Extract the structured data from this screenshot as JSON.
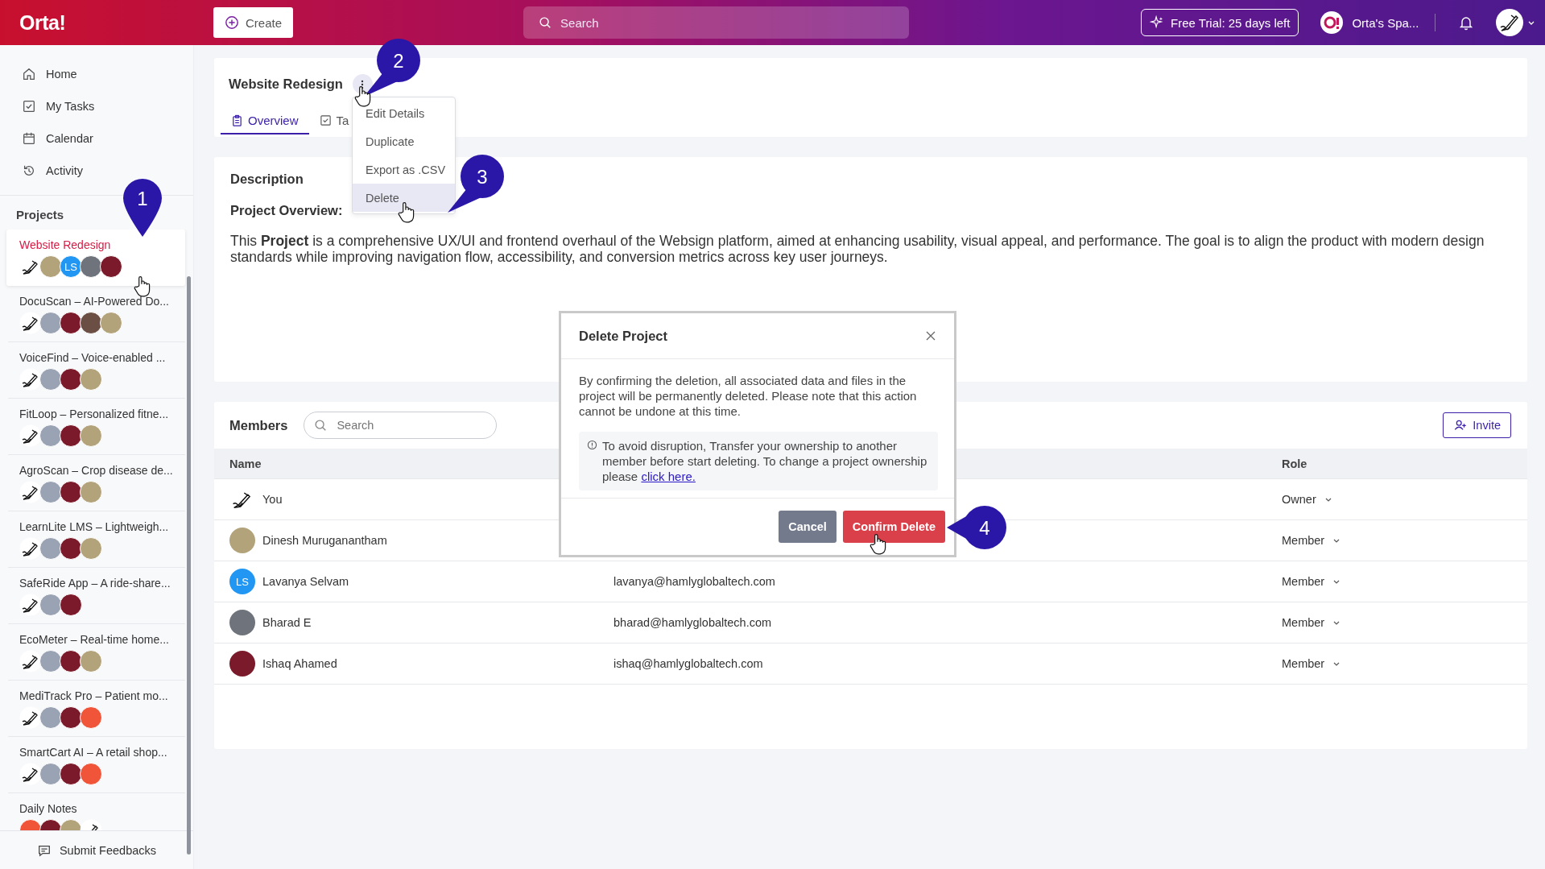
{
  "topbar": {
    "logo": "Orta!",
    "create_label": "Create",
    "search": {
      "placeholder": "Search"
    },
    "trial_label": "Free Trial: 25 days left",
    "workspace": "Orta's Spa..."
  },
  "nav": [
    {
      "label": "Home",
      "selected": false
    },
    {
      "label": "My Tasks",
      "selected": false
    },
    {
      "label": "Calendar",
      "selected": false
    },
    {
      "label": "Activity",
      "selected": false
    }
  ],
  "projects_heading": "Projects",
  "projects": [
    {
      "name": "Website Redesign",
      "selected": true,
      "avatars": [
        {
          "kind": "sketch"
        },
        {
          "kind": "photo",
          "color": "#b3a37a"
        },
        {
          "kind": "initials",
          "text": "LS",
          "color": "#2196f3"
        },
        {
          "kind": "photo",
          "color": "#6f747c"
        },
        {
          "kind": "photo",
          "color": "#7b1a2a"
        }
      ]
    },
    {
      "name": "DocuScan – AI-Powered Do...",
      "selected": false,
      "avatars": [
        {
          "kind": "sketch"
        },
        {
          "kind": "photo",
          "color": "#9aa3b3"
        },
        {
          "kind": "photo",
          "color": "#7b1a2a"
        },
        {
          "kind": "photo",
          "color": "#6b4f45"
        },
        {
          "kind": "photo",
          "color": "#b3a37a"
        }
      ]
    },
    {
      "name": "VoiceFind – Voice-enabled ...",
      "selected": false,
      "avatars": [
        {
          "kind": "sketch"
        },
        {
          "kind": "photo",
          "color": "#9aa3b3"
        },
        {
          "kind": "photo",
          "color": "#7b1a2a"
        },
        {
          "kind": "photo",
          "color": "#b3a37a"
        }
      ]
    },
    {
      "name": "FitLoop – Personalized fitne...",
      "selected": false,
      "avatars": [
        {
          "kind": "sketch"
        },
        {
          "kind": "photo",
          "color": "#9aa3b3"
        },
        {
          "kind": "photo",
          "color": "#7b1a2a"
        },
        {
          "kind": "photo",
          "color": "#b3a37a"
        }
      ]
    },
    {
      "name": "AgroScan – Crop disease de...",
      "selected": false,
      "avatars": [
        {
          "kind": "sketch"
        },
        {
          "kind": "photo",
          "color": "#9aa3b3"
        },
        {
          "kind": "photo",
          "color": "#7b1a2a"
        },
        {
          "kind": "photo",
          "color": "#b3a37a"
        }
      ]
    },
    {
      "name": "LearnLite LMS – Lightweigh...",
      "selected": false,
      "avatars": [
        {
          "kind": "sketch"
        },
        {
          "kind": "photo",
          "color": "#9aa3b3"
        },
        {
          "kind": "photo",
          "color": "#7b1a2a"
        },
        {
          "kind": "photo",
          "color": "#b3a37a"
        }
      ]
    },
    {
      "name": "SafeRide App – A ride-share...",
      "selected": false,
      "avatars": [
        {
          "kind": "sketch"
        },
        {
          "kind": "photo",
          "color": "#9aa3b3"
        },
        {
          "kind": "photo",
          "color": "#7b1a2a"
        }
      ]
    },
    {
      "name": "EcoMeter – Real-time home...",
      "selected": false,
      "avatars": [
        {
          "kind": "sketch"
        },
        {
          "kind": "photo",
          "color": "#9aa3b3"
        },
        {
          "kind": "photo",
          "color": "#7b1a2a"
        },
        {
          "kind": "photo",
          "color": "#b3a37a"
        }
      ]
    },
    {
      "name": "MediTrack Pro – Patient mo...",
      "selected": false,
      "avatars": [
        {
          "kind": "sketch"
        },
        {
          "kind": "photo",
          "color": "#9aa3b3"
        },
        {
          "kind": "photo",
          "color": "#7b1a2a"
        },
        {
          "kind": "photo",
          "color": "#f0553a"
        }
      ]
    },
    {
      "name": "SmartCart AI – A retail shop...",
      "selected": false,
      "avatars": [
        {
          "kind": "sketch"
        },
        {
          "kind": "photo",
          "color": "#9aa3b3"
        },
        {
          "kind": "photo",
          "color": "#7b1a2a"
        },
        {
          "kind": "photo",
          "color": "#f0553a"
        }
      ]
    },
    {
      "name": "Daily Notes",
      "selected": false,
      "avatars": [
        {
          "kind": "photo",
          "color": "#f0553a"
        },
        {
          "kind": "photo",
          "color": "#7b1a2a"
        },
        {
          "kind": "photo",
          "color": "#b3a37a"
        },
        {
          "kind": "sketch"
        }
      ]
    }
  ],
  "feedback_label": "Submit Feedbacks",
  "project_title": "Website Redesign",
  "tabs": [
    {
      "label": "Overview",
      "selected": true
    },
    {
      "label": "Ta",
      "selected": false
    }
  ],
  "menu": [
    {
      "label": "Edit Details",
      "selected": false
    },
    {
      "label": "Duplicate",
      "selected": false
    },
    {
      "label": "Export as .CSV",
      "selected": false
    },
    {
      "label": "Delete",
      "selected": true
    }
  ],
  "description": {
    "heading": "Description",
    "subheading": "Project Overview:",
    "text": "This **Project** is a comprehensive UX/UI and frontend overhaul of the Websign platform, aimed at enhancing usability, visual appeal, and performance. The goal is to align the product with modern design standards while improving navigation flow, accessibility, and conversion metrics across key user journeys."
  },
  "members": {
    "heading": "Members",
    "search": {
      "placeholder": "Search"
    },
    "invite_label": "Invite",
    "columns": {
      "name": "Name",
      "role": "Role"
    },
    "rows": [
      {
        "name": "You",
        "role": "Owner",
        "avatar": {
          "kind": "sketch"
        }
      },
      {
        "name": "Dinesh Muruganantham",
        "role": "Member",
        "avatar": {
          "kind": "photo",
          "color": "#b3a37a"
        }
      },
      {
        "name": "Lavanya Selvam",
        "email": "lavanya@hamlyglobaltech.com",
        "role": "Member",
        "avatar": {
          "kind": "initials",
          "text": "LS",
          "color": "#2196f3"
        }
      },
      {
        "name": "Bharad E",
        "email": "bharad@hamlyglobaltech.com",
        "role": "Member",
        "avatar": {
          "kind": "photo",
          "color": "#6f747c"
        }
      },
      {
        "name": "Ishaq Ahamed",
        "email": "ishaq@hamlyglobaltech.com",
        "role": "Member",
        "avatar": {
          "kind": "photo",
          "color": "#7b1a2a"
        }
      }
    ]
  },
  "dialog": {
    "title": "Delete Project",
    "message": "By confirming the deletion, all associated data and files in the project will be permanently deleted. Please note that this action cannot be undone at this time.",
    "note": "To avoid disruption, Transfer your ownership to another member before start deleting. To change a project ownership please",
    "note_link": "click here.",
    "cancel_label": "Cancel",
    "confirm_label": "Confirm Delete"
  },
  "callouts": [
    {
      "label": "1"
    },
    {
      "label": "2"
    },
    {
      "label": "3"
    },
    {
      "label": "4"
    }
  ]
}
